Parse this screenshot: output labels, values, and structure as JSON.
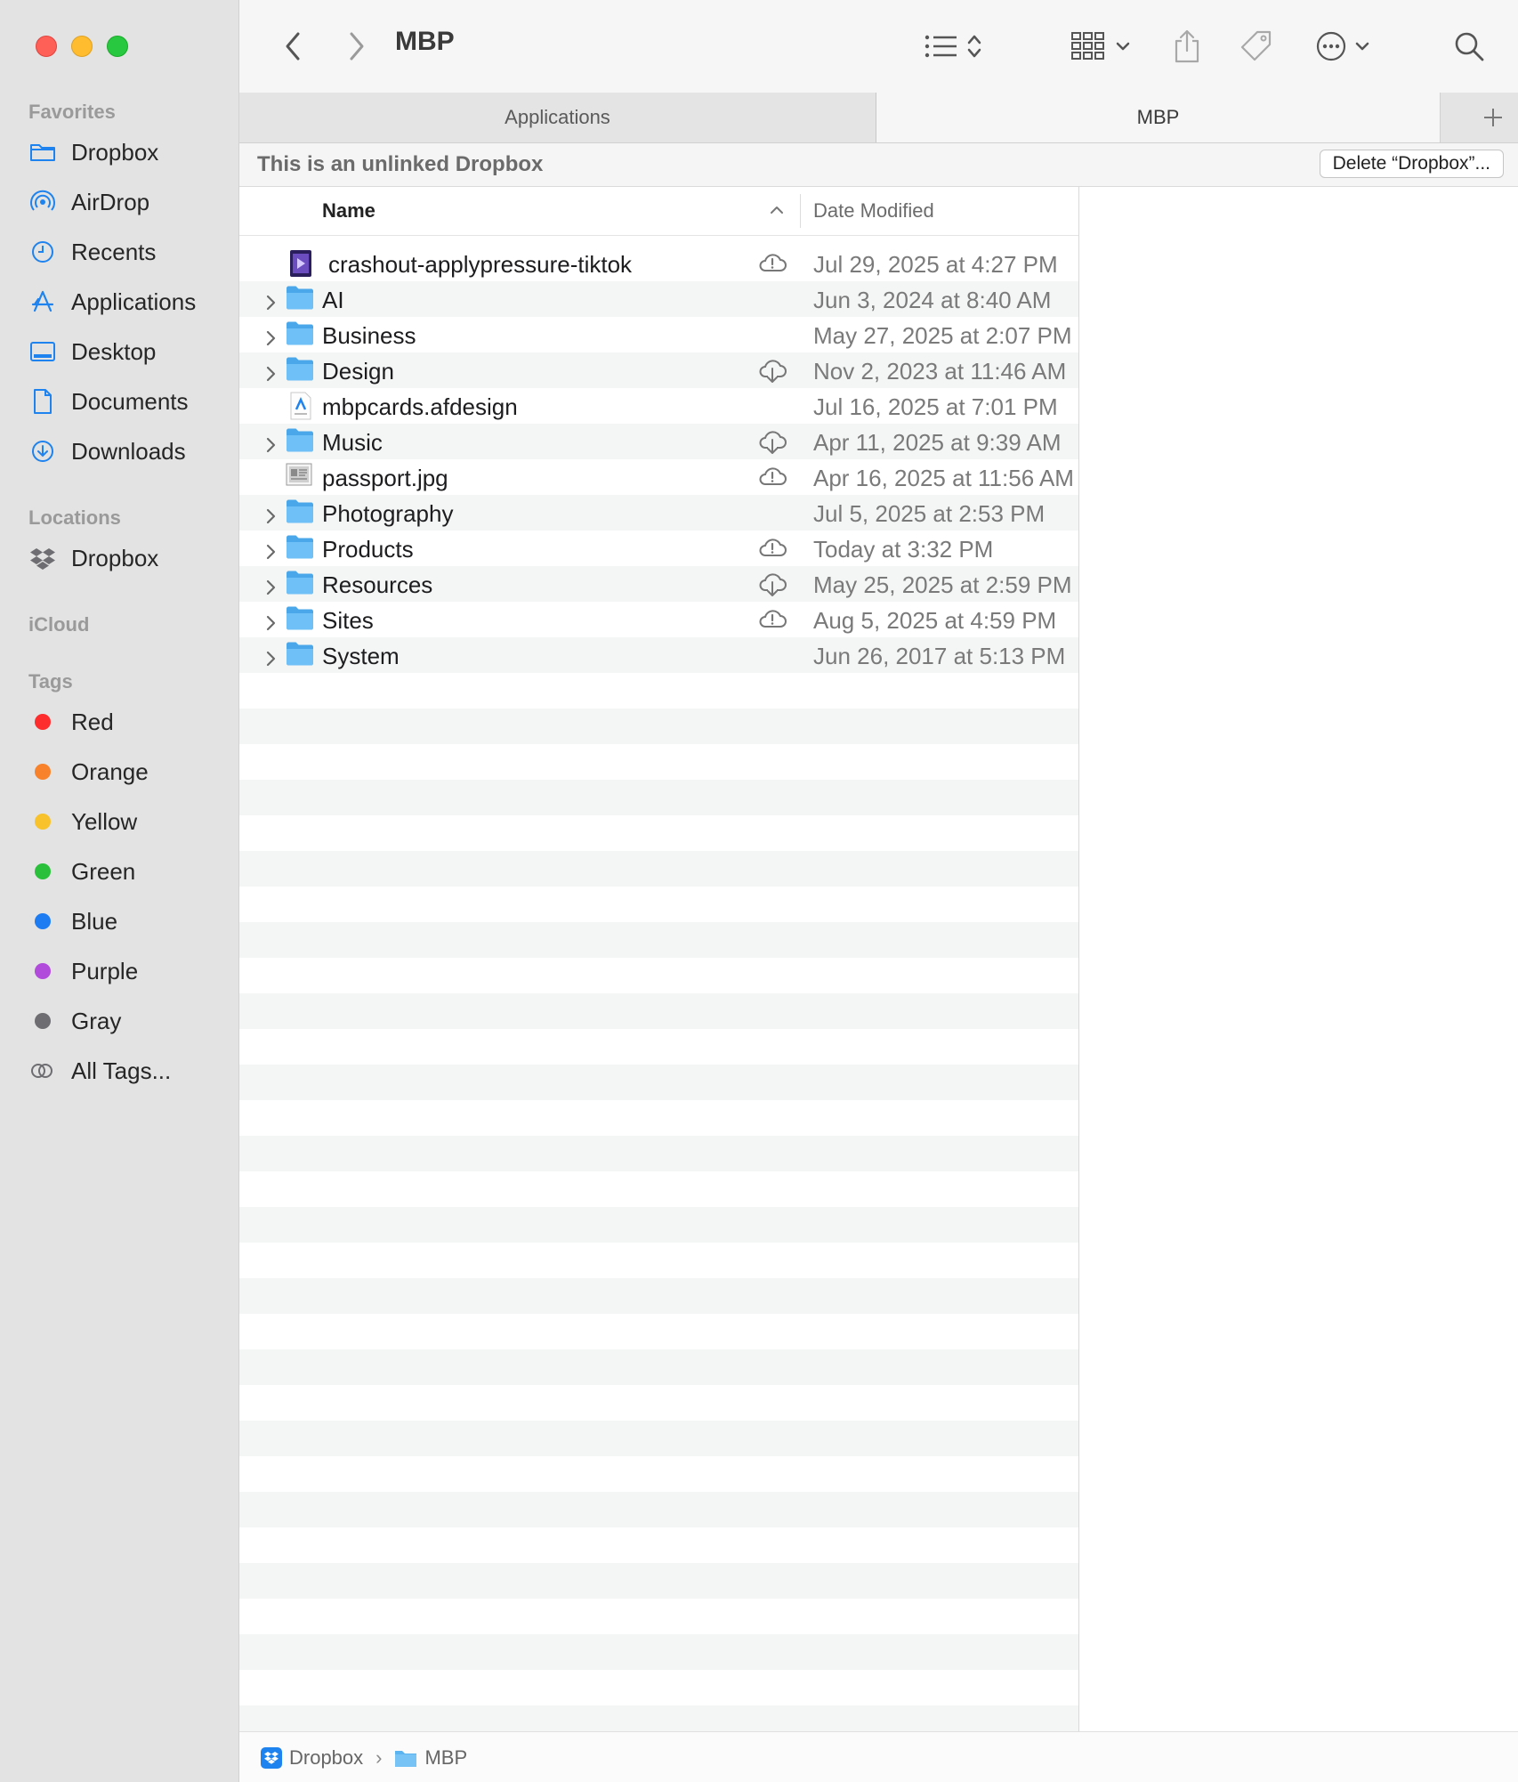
{
  "window": {
    "title": "MBP"
  },
  "sidebar": {
    "sections": {
      "favorites": "Favorites",
      "locations": "Locations",
      "icloud": "iCloud",
      "tags": "Tags"
    },
    "favorites": [
      {
        "label": "Dropbox",
        "icon": "folder-icon"
      },
      {
        "label": "AirDrop",
        "icon": "airdrop-icon"
      },
      {
        "label": "Recents",
        "icon": "clock-icon"
      },
      {
        "label": "Applications",
        "icon": "applications-icon"
      },
      {
        "label": "Desktop",
        "icon": "desktop-icon"
      },
      {
        "label": "Documents",
        "icon": "document-icon"
      },
      {
        "label": "Downloads",
        "icon": "download-icon"
      }
    ],
    "locations": [
      {
        "label": "Dropbox",
        "icon": "dropbox-icon"
      }
    ],
    "tags": [
      {
        "label": "Red",
        "color": "#fe2d2d"
      },
      {
        "label": "Orange",
        "color": "#f7822b"
      },
      {
        "label": "Yellow",
        "color": "#f7c22b"
      },
      {
        "label": "Green",
        "color": "#2ac03b"
      },
      {
        "label": "Blue",
        "color": "#1d7cf2"
      },
      {
        "label": "Purple",
        "color": "#b04bdc"
      },
      {
        "label": "Gray",
        "color": "#6e6e72"
      }
    ],
    "all_tags": "All Tags..."
  },
  "toolbar": {
    "title": "MBP"
  },
  "tabs": [
    {
      "label": "Applications",
      "active": false
    },
    {
      "label": "MBP",
      "active": true
    }
  ],
  "banner": {
    "text": "This is an unlinked Dropbox",
    "button": "Delete “Dropbox”..."
  },
  "list": {
    "columns": {
      "name": "Name",
      "date": "Date Modified"
    },
    "rows": [
      {
        "name": "crashout-applypressure-tiktok",
        "date": "Jul 29, 2025 at 4:27 PM",
        "kind": "video",
        "folder": false,
        "cloud": "alert"
      },
      {
        "name": "AI",
        "date": "Jun 3, 2024 at 8:40 AM",
        "kind": "folder",
        "folder": true,
        "cloud": ""
      },
      {
        "name": "Business",
        "date": "May 27, 2025 at 2:07 PM",
        "kind": "folder",
        "folder": true,
        "cloud": ""
      },
      {
        "name": "Design",
        "date": "Nov 2, 2023 at 11:46 AM",
        "kind": "folder",
        "folder": true,
        "cloud": "download"
      },
      {
        "name": "mbpcards.afdesign",
        "date": "Jul 16, 2025 at 7:01 PM",
        "kind": "afdesign",
        "folder": false,
        "cloud": ""
      },
      {
        "name": "Music",
        "date": "Apr 11, 2025 at 9:39 AM",
        "kind": "folder",
        "folder": true,
        "cloud": "download"
      },
      {
        "name": "passport.jpg",
        "date": "Apr 16, 2025 at 11:56 AM",
        "kind": "image",
        "folder": false,
        "cloud": "alert"
      },
      {
        "name": "Photography",
        "date": "Jul 5, 2025 at 2:53 PM",
        "kind": "folder",
        "folder": true,
        "cloud": ""
      },
      {
        "name": "Products",
        "date": "Today at 3:32 PM",
        "kind": "folder",
        "folder": true,
        "cloud": "alert"
      },
      {
        "name": "Resources",
        "date": "May 25, 2025 at 2:59 PM",
        "kind": "folder",
        "folder": true,
        "cloud": "download"
      },
      {
        "name": "Sites",
        "date": "Aug 5, 2025 at 4:59 PM",
        "kind": "folder",
        "folder": true,
        "cloud": "alert"
      },
      {
        "name": "System",
        "date": "Jun 26, 2017 at 5:13 PM",
        "kind": "folder",
        "folder": true,
        "cloud": ""
      }
    ]
  },
  "pathbar": [
    {
      "label": "Dropbox",
      "icon": "dropbox-icon"
    },
    {
      "label": "MBP",
      "icon": "folder-icon"
    }
  ],
  "colors": {
    "accent": "#1e83ee",
    "folder": "#5bb4f0",
    "sidebar_bg": "#e3e3e3"
  }
}
